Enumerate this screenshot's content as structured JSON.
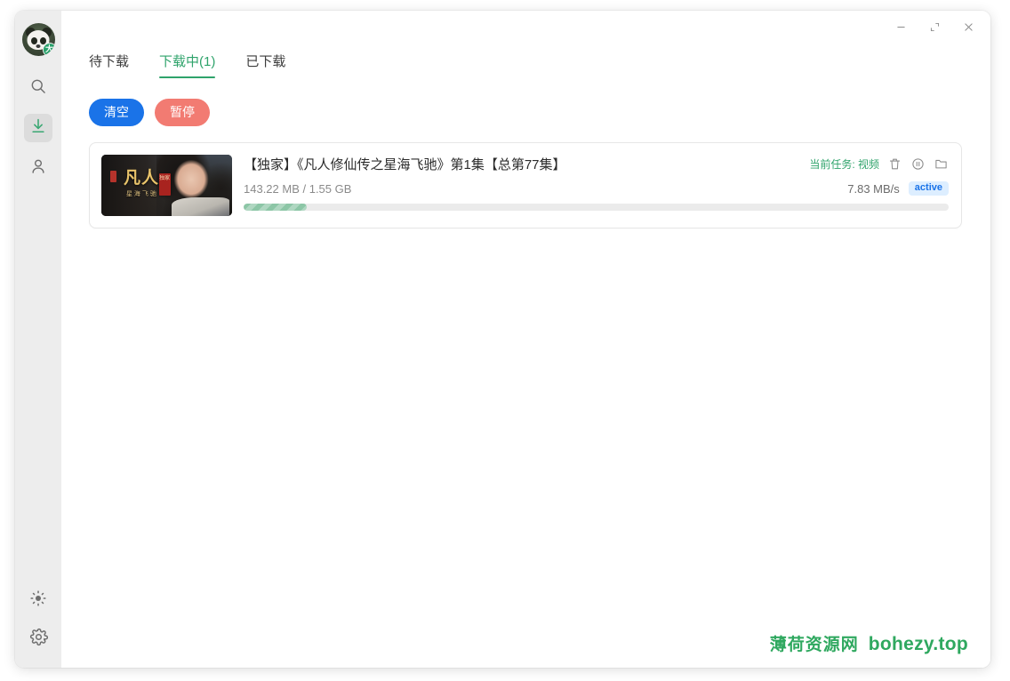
{
  "window": {
    "controls": {
      "minimize": "minimize-icon",
      "maximize": "maximize-icon",
      "close": "close-icon"
    }
  },
  "sidebar": {
    "avatar": {
      "name": "panda-avatar",
      "badge_text": "大"
    },
    "items": [
      {
        "name": "search",
        "icon": "search-icon",
        "active": false
      },
      {
        "name": "downloads",
        "icon": "download-icon",
        "active": true
      },
      {
        "name": "account",
        "icon": "user-icon",
        "active": false
      }
    ],
    "bottom_items": [
      {
        "name": "theme",
        "icon": "brightness-icon"
      },
      {
        "name": "settings",
        "icon": "gear-icon"
      }
    ]
  },
  "tabs": [
    {
      "label": "待下载",
      "active": false
    },
    {
      "label": "下载中(1)",
      "active": true
    },
    {
      "label": "已下载",
      "active": false
    }
  ],
  "toolbar": {
    "clear_label": "清空",
    "pause_label": "暂停",
    "clear_color": "#1a73e8",
    "pause_color": "#f27b72"
  },
  "downloads": [
    {
      "title": "【独家】《凡人修仙传之星海飞驰》第1集【总第77集】",
      "size_text": "143.22 MB / 1.55 GB",
      "downloaded": "143.22 MB",
      "total": "1.55 GB",
      "speed": "7.83 MB/s",
      "status_badge": "active",
      "current_task_label": "当前任务: 视频",
      "progress_percent": 9,
      "thumbnail": {
        "logo_text": "凡人",
        "sub_text": "星海飞驰",
        "seal_text": "独家"
      },
      "row_icons": [
        {
          "name": "delete-icon"
        },
        {
          "name": "pause-icon"
        },
        {
          "name": "open-folder-icon"
        }
      ]
    }
  ],
  "watermark": {
    "cn": "薄荷资源网",
    "en": "bohezy.top",
    "color": "#2fa85f"
  }
}
